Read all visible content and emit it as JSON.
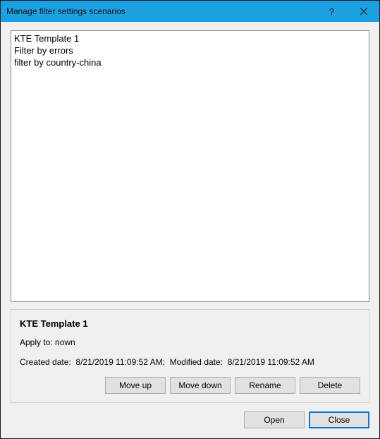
{
  "titlebar": {
    "title": "Manage filter settings scenarios",
    "help": "?",
    "close": "×"
  },
  "list": {
    "items": [
      "KTE Template 1",
      "Filter by errors",
      "filter by country-china"
    ]
  },
  "details": {
    "title": "KTE Template 1",
    "apply_label": "Apply to:",
    "apply_value": "nown",
    "created_label": "Created date:",
    "created_value": "8/21/2019 11:09:52 AM",
    "modified_label": "Modified date:",
    "modified_value": "8/21/2019 11:09:52 AM"
  },
  "buttons": {
    "move_up": "Move up",
    "move_down": "Move down",
    "rename": "Rename",
    "delete": "Delete",
    "open": "Open",
    "close": "Close"
  }
}
